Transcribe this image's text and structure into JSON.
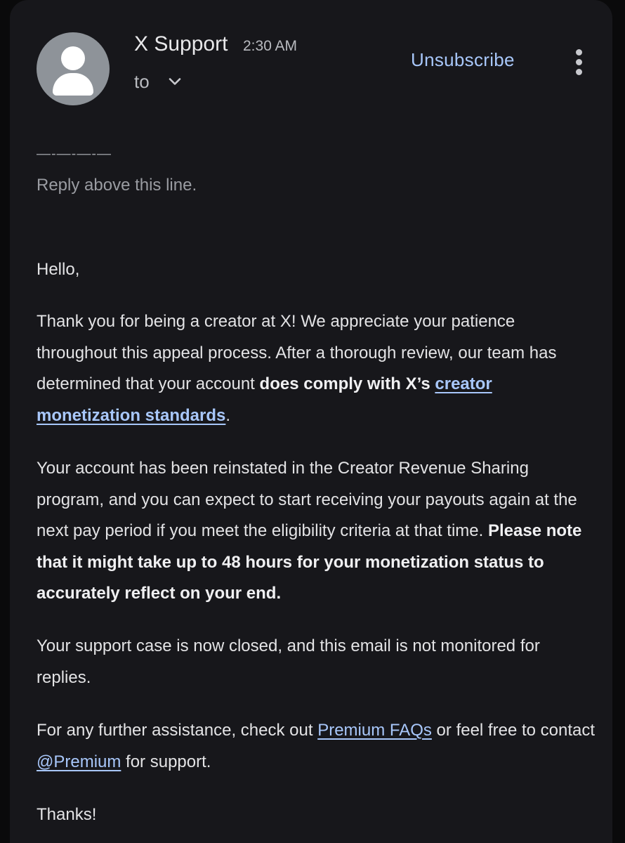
{
  "header": {
    "sender": "X Support",
    "time": "2:30 AM",
    "to_label": "to",
    "unsubscribe_label": "Unsubscribe",
    "expand_icon": "chevron-down-icon",
    "more_icon": "more-vert-icon",
    "avatar_icon": "default-avatar-icon"
  },
  "email": {
    "divider": "—-—-—-—",
    "reply_above": "Reply above this line.",
    "greeting": "Hello,",
    "p1_part1": "Thank you for being a creator at X! We appreciate your patience throughout this appeal process. After a thorough review, our team has determined that your account ",
    "p1_bold": "does comply with X’s",
    "p1_space": " ",
    "p1_link": "creator monetization standards",
    "p1_end": ".",
    "p2_part1": "Your account has been reinstated in the Creator Revenue Sharing program, and you can expect to start receiving your payouts again at the next pay period if you meet the eligibility criteria at that time. ",
    "p2_bold": "Please note that it might take up to 48 hours for your monetization status to accurately reflect on your end.",
    "p3": "Your support case is now closed, and this email is not monitored for replies.",
    "p4_part1": "For any further assistance, check out ",
    "p4_link1": "Premium FAQs",
    "p4_part2": " or feel free to contact ",
    "p4_link2": "@Premium",
    "p4_part3": " for support.",
    "closing": "Thanks!"
  },
  "colors": {
    "background": "#17171b",
    "link": "#a8c7fa",
    "text": "#e3e3e5",
    "muted": "#9a9ca2"
  }
}
